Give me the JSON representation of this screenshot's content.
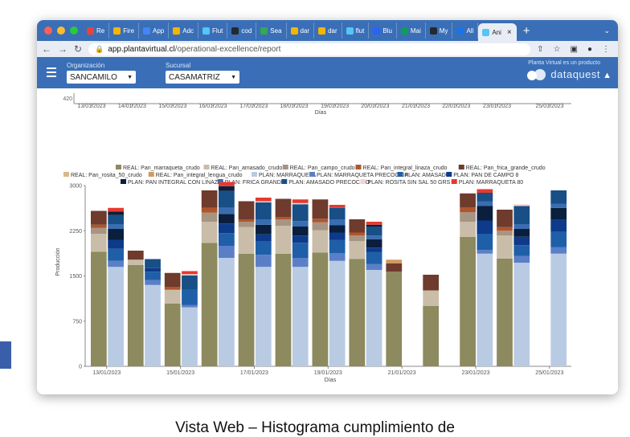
{
  "browser": {
    "tabs": [
      {
        "label": "Re",
        "color": "#ea4335"
      },
      {
        "label": "Fire",
        "color": "#f4b400"
      },
      {
        "label": "App",
        "color": "#4285f4"
      },
      {
        "label": "Adc",
        "color": "#f4b400"
      },
      {
        "label": "Flut",
        "color": "#54c5f8"
      },
      {
        "label": "cod",
        "color": "#24292e"
      },
      {
        "label": "Sea",
        "color": "#34a853"
      },
      {
        "label": "dar",
        "color": "#f4b400"
      },
      {
        "label": "dar",
        "color": "#f4b400"
      },
      {
        "label": "flut",
        "color": "#54c5f8"
      },
      {
        "label": "Blu",
        "color": "#2962ff"
      },
      {
        "label": "Mai",
        "color": "#0f9d58"
      },
      {
        "label": "My",
        "color": "#24292e"
      },
      {
        "label": "All",
        "color": "#1a73e8"
      },
      {
        "label": "Ani",
        "color": "#54c5f8"
      }
    ],
    "url_host": "app.plantavirtual.cl",
    "url_path": "/operational-excellence/report"
  },
  "appbar": {
    "org_label": "Organización",
    "org_value": "SANCAMILO",
    "branch_label": "Sucursal",
    "branch_value": "CASAMATRIZ",
    "brand_note": "Planta Virtual es un producto",
    "brand_name": "dataquest"
  },
  "top_axis": {
    "y_label_value": "420",
    "xlabel": "Días",
    "ticks": [
      "13/01/2023",
      "14/01/2023",
      "15/01/2023",
      "16/01/2023",
      "17/01/2023",
      "18/01/2023",
      "19/01/2023",
      "20/01/2023",
      "21/01/2023",
      "22/01/2023",
      "23/01/2023",
      "25/01/2023"
    ]
  },
  "chart_data": {
    "type": "bar",
    "xlabel": "Días",
    "ylabel": "Producción",
    "ylim": [
      0,
      3000
    ],
    "yticks": [
      "0",
      "750",
      "1500",
      "2250",
      "3000"
    ],
    "tick_labels": [
      "13/01/2023",
      "15/01/2023",
      "17/01/2023",
      "19/01/2023",
      "21/01/2023",
      "23/01/2023",
      "25/01/2023"
    ],
    "legend_position": "top",
    "legend": [
      {
        "name": "REAL: Pan_marraqueta_crudo",
        "color": "#8c8a5e"
      },
      {
        "name": "REAL: Pan_amasado_crudo",
        "color": "#c9bda9"
      },
      {
        "name": "REAL: Pan_campo_crudo",
        "color": "#a89482"
      },
      {
        "name": "REAL: Pan_integral_linaza_crudo",
        "color": "#b0562d"
      },
      {
        "name": "REAL: Pan_frica_grande_crudo",
        "color": "#6e3b2c"
      },
      {
        "name": "REAL: Pan_rosita_50_crudo",
        "color": "#d8b88a"
      },
      {
        "name": "REAL: Pan_integral_lengua_crudo",
        "color": "#d09a62"
      },
      {
        "name": "PLAN: MARRAQUETA",
        "color": "#b9cbe2"
      },
      {
        "name": "PLAN: MARRAQUETA PRECOCIDA",
        "color": "#5b7fc7"
      },
      {
        "name": "PLAN: AMASADO",
        "color": "#1f5fa8"
      },
      {
        "name": "PLAN: PAN DE CAMPO 8",
        "color": "#0d3a8a"
      },
      {
        "name": "PLAN: PAN INTEGRAL CON LINAZA",
        "color": "#0a1f3d"
      },
      {
        "name": "PLAN: FRICA GRANDE",
        "color": "#3a6db0"
      },
      {
        "name": "PLAN: AMASADO PRECOCIDO",
        "color": "#174f86"
      },
      {
        "name": "PLAN: ROSITA SIN SAL 50 GRS",
        "color": "#f3d3d3"
      },
      {
        "name": "PLAN: MARRAQUETA 80",
        "color": "#e63a2e"
      }
    ],
    "days": [
      {
        "real": [
          1900,
          300,
          100,
          50,
          230,
          0,
          0
        ],
        "plan": [
          1650,
          100,
          200,
          150,
          180,
          80,
          150,
          60,
          0,
          60
        ]
      },
      {
        "real": [
          1680,
          90,
          0,
          0,
          150,
          0,
          0
        ],
        "plan": [
          1350,
          80,
          140,
          60,
          0,
          0,
          150,
          0,
          0,
          0
        ]
      },
      {
        "real": [
          1040,
          230,
          0,
          50,
          230,
          0,
          0
        ],
        "plan": [
          980,
          40,
          260,
          0,
          0,
          0,
          230,
          0,
          20,
          50
        ]
      },
      {
        "real": [
          2050,
          350,
          150,
          80,
          290,
          0,
          0
        ],
        "plan": [
          1800,
          200,
          210,
          160,
          160,
          100,
          280,
          80,
          0,
          70
        ]
      },
      {
        "real": [
          1870,
          440,
          90,
          40,
          300,
          0,
          0
        ],
        "plan": [
          1650,
          200,
          230,
          110,
          160,
          90,
          280,
          0,
          20,
          60
        ]
      },
      {
        "real": [
          1870,
          460,
          110,
          40,
          300,
          0,
          0
        ],
        "plan": [
          1650,
          150,
          250,
          120,
          150,
          90,
          280,
          0,
          20,
          60
        ]
      },
      {
        "real": [
          1890,
          370,
          130,
          60,
          320,
          0,
          0
        ],
        "plan": [
          1750,
          130,
          220,
          120,
          120,
          100,
          190,
          0,
          0,
          50
        ]
      },
      {
        "real": [
          1780,
          300,
          90,
          50,
          220,
          0,
          0
        ],
        "plan": [
          1600,
          100,
          200,
          70,
          140,
          60,
          150,
          30,
          0,
          50
        ]
      },
      {
        "real": [
          1570,
          0,
          0,
          0,
          140,
          0,
          60
        ],
        "plan": [
          0,
          0,
          0,
          0,
          0,
          0,
          0,
          0,
          0,
          0
        ]
      },
      {
        "real": [
          1000,
          260,
          0,
          0,
          260,
          0,
          0
        ],
        "plan": [
          0,
          0,
          0,
          0,
          0,
          0,
          0,
          0,
          0,
          0
        ]
      },
      {
        "real": [
          2150,
          250,
          160,
          80,
          230,
          0,
          0
        ],
        "plan": [
          1870,
          60,
          270,
          220,
          240,
          80,
          140,
          0,
          0,
          60
        ]
      },
      {
        "real": [
          1790,
          380,
          80,
          60,
          290,
          0,
          0
        ],
        "plan": [
          1720,
          110,
          180,
          140,
          130,
          80,
          300,
          0,
          30,
          0
        ]
      },
      {
        "real": [
          0,
          0,
          0,
          0,
          0,
          0,
          0
        ],
        "plan": [
          1870,
          110,
          250,
          200,
          200,
          70,
          220,
          0,
          0,
          0
        ]
      }
    ],
    "real_colors": [
      "#8c8a5e",
      "#c9bda9",
      "#a89482",
      "#b0562d",
      "#6e3b2c",
      "#d8b88a",
      "#d09a62"
    ],
    "plan_colors": [
      "#b9cbe2",
      "#5b7fc7",
      "#1f5fa8",
      "#0d3a8a",
      "#0a1f3d",
      "#3a6db0",
      "#174f86",
      "#0a1f3d",
      "#f3d3d3",
      "#e63a2e"
    ]
  },
  "caption": "Vista Web – Histograma cumplimiento de"
}
